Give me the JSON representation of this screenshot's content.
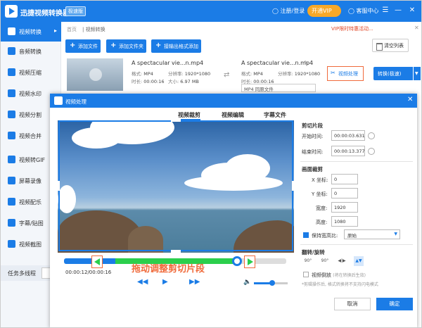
{
  "app": {
    "title": "迅捷视频转换器",
    "edition": "极速版",
    "user": "注册/登录",
    "vip": "开通VIP",
    "service": "客服中心"
  },
  "sidebar": {
    "items": [
      {
        "label": "视频转换",
        "active": true
      },
      {
        "label": "音频转换"
      },
      {
        "label": "视频压缩"
      },
      {
        "label": "视频水印"
      },
      {
        "label": "视频分割"
      },
      {
        "label": "视频合并"
      },
      {
        "label": "视频转GIF"
      },
      {
        "label": "屏幕录像"
      },
      {
        "label": "视频配乐"
      },
      {
        "label": "字幕/贴图"
      },
      {
        "label": "视频截图"
      }
    ],
    "footer": "任务多线程"
  },
  "breadcrumb": {
    "home": "首页",
    "current": "视频转换"
  },
  "notice": "VIP限时特惠活动...",
  "toolbar": {
    "add_file": "添加文件",
    "add_folder": "添加文件夹",
    "watch_folder": "接输出格式添加",
    "clear": "清空列表"
  },
  "file": {
    "source_name": "A spectacular vie...n.mp4",
    "source_format_label": "格式:",
    "source_format": "MP4",
    "source_res_label": "分辨率:",
    "source_res": "1920*1080",
    "source_dur_label": "时长:",
    "source_dur": "00:00:16",
    "source_size_label": "大小:",
    "source_size": "6.97 MB",
    "target_name": "A spectacular vie...n.mp4",
    "target_format_label": "格式:",
    "target_format": "MP4",
    "target_res_label": "分辨率:",
    "target_res": "1920*1080",
    "target_dur_label": "时长:",
    "target_dur": "00:00:16",
    "format_select": "MP4  同原文件",
    "video_process": "视频处理",
    "convert": "转换(极速)"
  },
  "dialog": {
    "title": "视频处理",
    "tabs": [
      "视频裁剪",
      "视频编辑",
      "字幕文件"
    ],
    "active_tab": 0,
    "time_current": "00:00:12/00:00:16",
    "hint": "拖动调整剪切片段",
    "timeline": {
      "progress_fraction": 0.78,
      "clip_start_fraction": 0.23,
      "clip_end_fraction": 0.78
    },
    "volume_fraction": 0.55,
    "clip": {
      "section": "剪切片段",
      "start_label": "开始时间:",
      "start_value": "00:00:03.631",
      "end_label": "结束时间:",
      "end_value": "00:00:13.377"
    },
    "crop": {
      "section": "画面裁剪",
      "x_label": "X 坐标:",
      "x_value": "0",
      "y_label": "Y 坐标:",
      "y_value": "0",
      "w_label": "宽度:",
      "w_value": "1920",
      "h_label": "高度:",
      "h_value": "1080",
      "keep_ratio_label": "保持宽高比:",
      "ratio_value": "原始"
    },
    "rotate": {
      "section": "翻转/旋转",
      "flip_label": "视频倒放",
      "flip_note": "(将在转换后生效)",
      "note": "*剪辑操作后, 格式转换将不支持闪电模式"
    },
    "cancel": "取消",
    "ok": "确定"
  },
  "colors": {
    "primary": "#1b7ce6",
    "accent": "#f06b3c",
    "clip_green": "#2bcf4c",
    "vip": "#f7a828"
  }
}
